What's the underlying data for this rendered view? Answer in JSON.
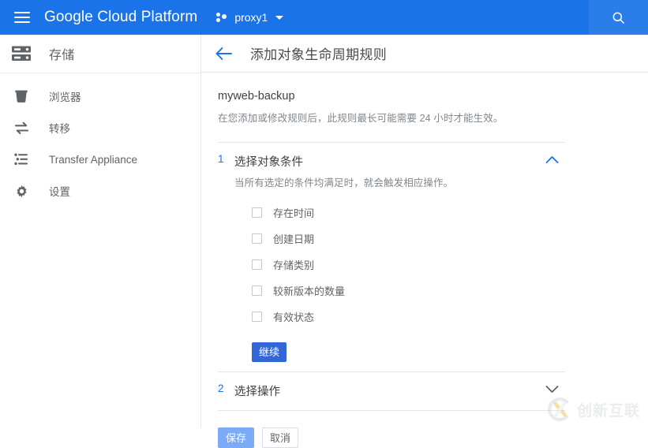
{
  "appbar": {
    "menu_icon": "hamburger-icon",
    "brand": "Google Cloud Platform",
    "project_icon": "project-dots-icon",
    "project_name": "proxy1",
    "project_caret": "chevron-down-icon",
    "search_icon": "search-icon",
    "background_color": "#1a73e8",
    "search_background_color": "#2b7de9"
  },
  "sidebar": {
    "header": {
      "icon": "storage-stack-icon",
      "title": "存储"
    },
    "items": [
      {
        "icon": "bucket-icon",
        "label": "浏览器"
      },
      {
        "icon": "transfer-arrows-icon",
        "label": "转移"
      },
      {
        "icon": "transfer-appliance-icon",
        "label": "Transfer Appliance"
      },
      {
        "icon": "gear-icon",
        "label": "设置"
      }
    ]
  },
  "page": {
    "back_icon": "arrow-left-icon",
    "title": "添加对象生命周期规则",
    "bucket_name": "myweb-backup",
    "hint": "在您添加或修改规则后，此规则最长可能需要 24 小时才能生效。"
  },
  "steps": [
    {
      "number": "1",
      "title": "选择对象条件",
      "subtitle": "当所有选定的条件均满足时，就会触发相应操作。",
      "chevron_icon": "chevron-up-icon",
      "expanded": true,
      "conditions": [
        {
          "label": "存在时间",
          "checked": false
        },
        {
          "label": "创建日期",
          "checked": false
        },
        {
          "label": "存储类别",
          "checked": false
        },
        {
          "label": "较新版本的数量",
          "checked": false
        },
        {
          "label": "有效状态",
          "checked": false
        }
      ],
      "continue_label": "继续"
    },
    {
      "number": "2",
      "title": "选择操作",
      "chevron_icon": "chevron-down-icon",
      "expanded": false
    }
  ],
  "actions": {
    "save_label": "保存",
    "cancel_label": "取消",
    "save_color": "#7baaf7",
    "continue_color": "#3367d6"
  },
  "watermark": {
    "text": "创新互联",
    "mark_icon": "cx-logo-icon"
  }
}
